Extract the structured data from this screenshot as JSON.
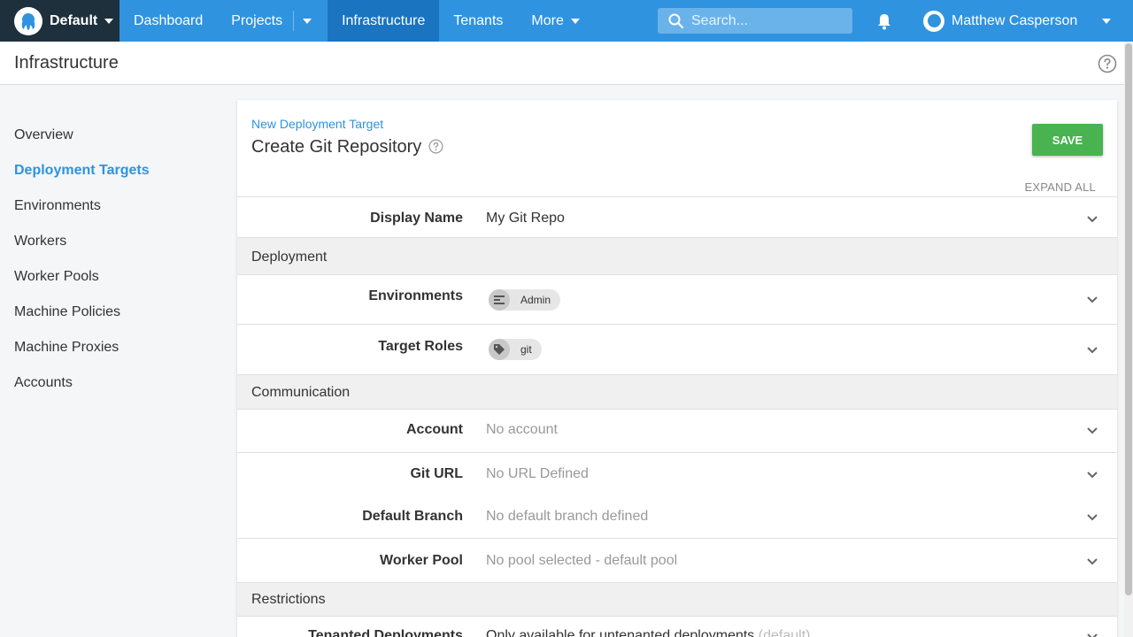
{
  "nav": {
    "space": "Default",
    "items": [
      {
        "label": "Dashboard"
      },
      {
        "label": "Projects"
      },
      {
        "label": "Infrastructure"
      },
      {
        "label": "Tenants"
      },
      {
        "label": "More"
      }
    ],
    "search_placeholder": "Search...",
    "user_name": "Matthew Casperson"
  },
  "page": {
    "title": "Infrastructure"
  },
  "sidebar": {
    "items": [
      {
        "label": "Overview"
      },
      {
        "label": "Deployment Targets"
      },
      {
        "label": "Environments"
      },
      {
        "label": "Workers"
      },
      {
        "label": "Worker Pools"
      },
      {
        "label": "Machine Policies"
      },
      {
        "label": "Machine Proxies"
      },
      {
        "label": "Accounts"
      }
    ],
    "active": "Deployment Targets"
  },
  "form": {
    "breadcrumb": "New Deployment Target",
    "title": "Create Git Repository",
    "save_label": "SAVE",
    "expand_all_label": "EXPAND ALL",
    "display_name": {
      "label": "Display Name",
      "value": "My Git Repo"
    },
    "deployment_section": "Deployment",
    "environments": {
      "label": "Environments",
      "chip": "Admin"
    },
    "target_roles": {
      "label": "Target Roles",
      "chip": "git"
    },
    "communication_section": "Communication",
    "account": {
      "label": "Account",
      "value": "No account"
    },
    "git_url": {
      "label": "Git URL",
      "value": "No URL Defined"
    },
    "default_branch": {
      "label": "Default Branch",
      "value": "No default branch defined"
    },
    "worker_pool": {
      "label": "Worker Pool",
      "value": "No pool selected - default pool"
    },
    "restrictions_section": "Restrictions",
    "tenanted": {
      "label": "Tenanted Deployments",
      "value": "Only available for untenanted deployments",
      "suffix": "(default)"
    }
  },
  "colors": {
    "nav_blue": "#2f93e0",
    "nav_active": "#1a74c0",
    "space_bg": "#1f303d",
    "save_green": "#48b350"
  }
}
